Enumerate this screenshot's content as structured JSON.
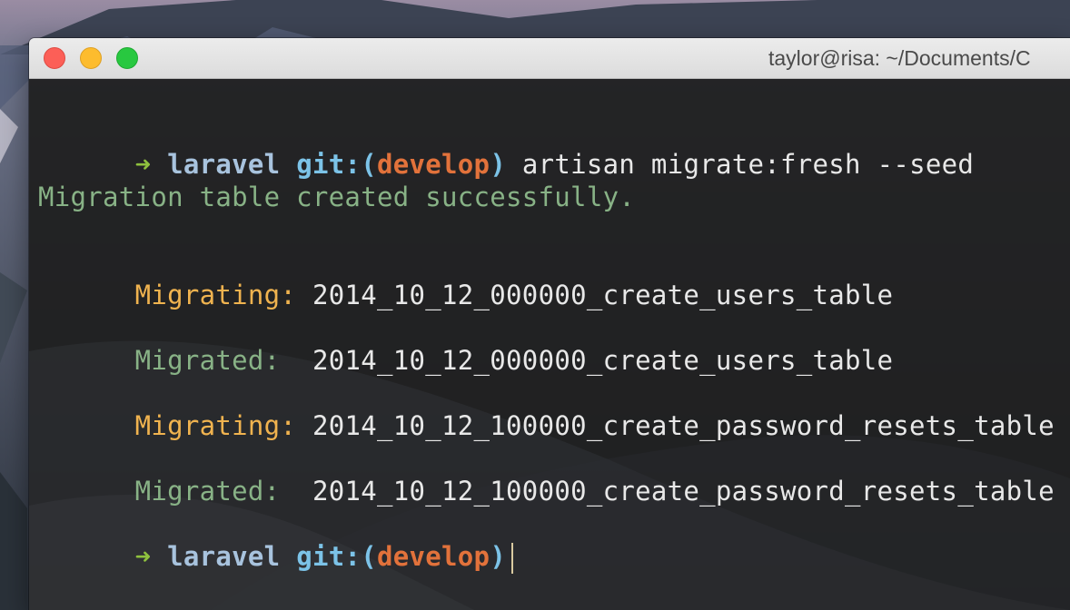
{
  "window": {
    "title": "taylor@risa: ~/Documents/C"
  },
  "prompt": {
    "arrow": "➜",
    "directory": "laravel",
    "git_prefix": "git:(",
    "branch": "develop",
    "git_suffix": ")"
  },
  "lines": [
    {
      "command": "artisan migrate:fresh --seed"
    },
    {
      "text": "Migration table created successfully."
    },
    {
      "label": "Migrating:",
      "value": "2014_10_12_000000_create_users_table"
    },
    {
      "label": "Migrated:",
      "value": "2014_10_12_000000_create_users_table"
    },
    {
      "label": "Migrating:",
      "value": "2014_10_12_100000_create_password_resets_table"
    },
    {
      "label": "Migrated:",
      "value": "2014_10_12_100000_create_password_resets_table"
    }
  ],
  "colors": {
    "arrow": "#8fc13e",
    "directory": "#a8c3de",
    "git": "#7cc3e8",
    "branch": "#e2723b",
    "info": "#88b286",
    "comment": "#f0b34f",
    "close": "#fc5f57",
    "minimize": "#fdbc2e",
    "zoom": "#28c840"
  }
}
